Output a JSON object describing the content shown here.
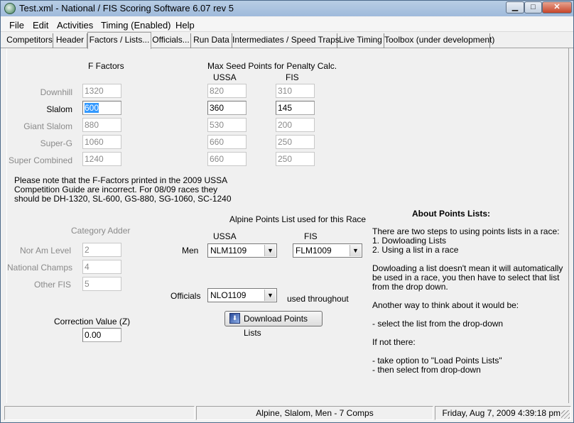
{
  "window": {
    "title": "Test.xml - National / FIS Scoring Software 6.07 rev 5",
    "controls": {
      "minimize": "▁",
      "maximize": "□",
      "close": "✕"
    }
  },
  "menu": [
    "File",
    "Edit",
    "Activities",
    "Timing (Enabled)",
    "Help"
  ],
  "tabs": [
    "Competitors",
    "Header",
    "Factors / Lists...",
    "Officials...",
    "Run Data",
    "Intermediates / Speed Traps",
    "Live Timing",
    "Toolbox (under development)"
  ],
  "active_tab": "Factors / Lists...",
  "f_factors": {
    "heading": "F Factors",
    "rows": [
      {
        "label": "Downhill",
        "value": "1320",
        "enabled": false
      },
      {
        "label": "Slalom",
        "value": "600",
        "enabled": true
      },
      {
        "label": "Giant Slalom",
        "value": "880",
        "enabled": false
      },
      {
        "label": "Super-G",
        "value": "1060",
        "enabled": false
      },
      {
        "label": "Super Combined",
        "value": "1240",
        "enabled": false
      }
    ]
  },
  "max_seed": {
    "heading": "Max Seed Points for Penalty Calc.",
    "col_ussa": "USSA",
    "col_fis": "FIS",
    "ussa": [
      "820",
      "360",
      "530",
      "660",
      "660"
    ],
    "fis": [
      "310",
      "145",
      "200",
      "250",
      "250"
    ]
  },
  "note": {
    "line1": "Please note that the F-Factors printed in the 2009 USSA",
    "line2": "Competition Guide are incorrect. For 08/09 races they",
    "line3": "should be DH-1320, SL-600, GS-880, SG-1060, SC-1240"
  },
  "category_adder": {
    "heading": "Category Adder",
    "rows": [
      {
        "label": "Nor Am Level",
        "value": "2"
      },
      {
        "label": "National Champs",
        "value": "4"
      },
      {
        "label": "Other FIS",
        "value": "5"
      }
    ]
  },
  "correction": {
    "label": "Correction Value (Z)",
    "value": "0.00"
  },
  "points_list": {
    "heading": "Alpine Points List used for this Race",
    "col_ussa": "USSA",
    "col_fis": "FIS",
    "men_label": "Men",
    "men_ussa": "NLM1109",
    "men_fis": "FLM1009",
    "officials_label": "Officials",
    "officials_value": "NLO1109",
    "used_throughout": "used throughout",
    "download_button": "Download Points Lists"
  },
  "about": {
    "heading": "About Points Lists:",
    "lines": [
      "There are two steps to using points lists in a race:",
      "1. Dowloading Lists",
      "2. Using a list in a race",
      "",
      "Dowloading a list doesn't mean it will automatically",
      "be used in a race, you then have to select that list",
      "from the drop down.",
      "",
      "Another way to think about it would be:",
      "",
      "- select the list from the drop-down",
      "",
      "If not there:",
      "",
      "- take option to \"Load Points Lists\"",
      "- then select from drop-down"
    ]
  },
  "status": {
    "left": "",
    "center": "Alpine, Slalom, Men - 7 Comps",
    "right": "Friday, Aug 7, 2009  4:39:18 pm"
  }
}
